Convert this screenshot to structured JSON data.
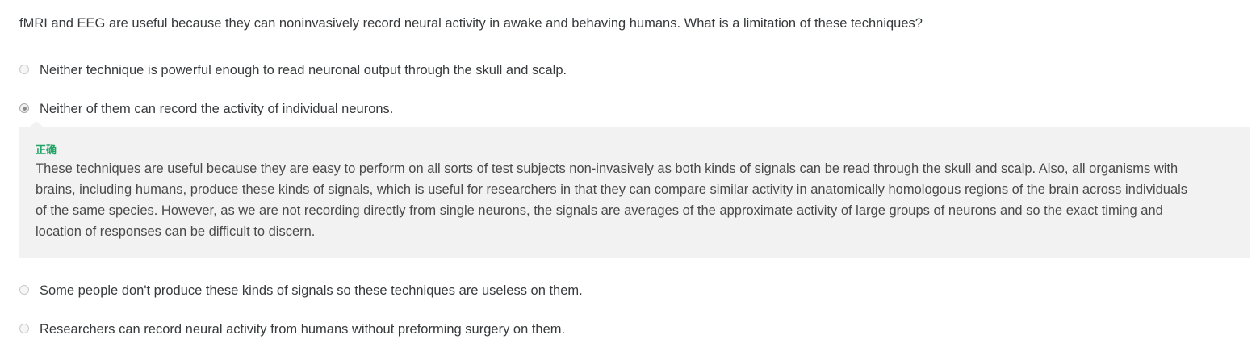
{
  "question": {
    "text": "fMRI and EEG are useful because they can noninvasively record neural activity in awake and behaving humans. What is a limitation of these techniques?"
  },
  "options": [
    {
      "label": "Neither technique is powerful enough to read neuronal output through the skull and scalp.",
      "selected": false
    },
    {
      "label": "Neither of them can record the activity of individual neurons.",
      "selected": true
    },
    {
      "label": "Some people don't produce these kinds of signals so these techniques are useless on them.",
      "selected": false
    },
    {
      "label": "Researchers can record neural activity from humans without preforming surgery on them.",
      "selected": false
    }
  ],
  "feedback": {
    "status": "正确",
    "status_color": "#21a366",
    "text": "These techniques are useful because they are easy to perform on all sorts of test subjects non-invasively as both kinds of signals can be read through the skull and scalp. Also, all organisms with brains, including humans, produce these kinds of signals, which is useful for researchers in that they can compare similar activity in anatomically homologous regions of the brain across individuals of the same species. However, as we are not recording directly from single neurons, the signals are averages of the approximate activity of large groups of neurons and so the exact timing and location of responses can be difficult to discern."
  },
  "colors": {
    "text": "#373a3c",
    "feedback_background": "#f2f2f2",
    "correct": "#21a366"
  }
}
